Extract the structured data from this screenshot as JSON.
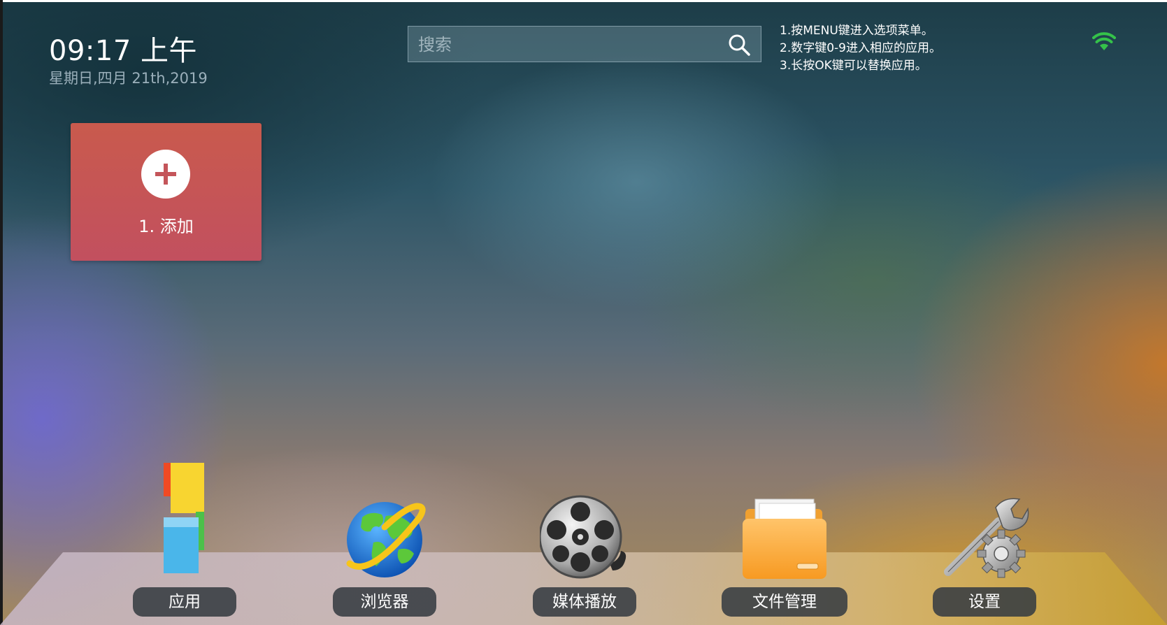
{
  "status": {
    "time": "09:17 上午",
    "date": "星期日,四月 21th,2019"
  },
  "search": {
    "placeholder": "搜索",
    "icon": "search-icon"
  },
  "instructions": [
    "1.按MENU键进入选项菜单。",
    "2.数字键0-9进入相应的应用。",
    "3.长按OK键可以替换应用。"
  ],
  "wifi": {
    "icon": "wifi-icon",
    "color": "#35c24a"
  },
  "add_tile": {
    "label": "1. 添加",
    "icon": "plus-icon",
    "color": "#c4555a"
  },
  "dock": {
    "items": [
      {
        "label": "应用",
        "icon": "apps-blocks-icon"
      },
      {
        "label": "浏览器",
        "icon": "globe-browser-icon"
      },
      {
        "label": "媒体播放",
        "icon": "film-reel-icon"
      },
      {
        "label": "文件管理",
        "icon": "folder-icon"
      },
      {
        "label": "设置",
        "icon": "wrench-gear-icon"
      }
    ]
  }
}
